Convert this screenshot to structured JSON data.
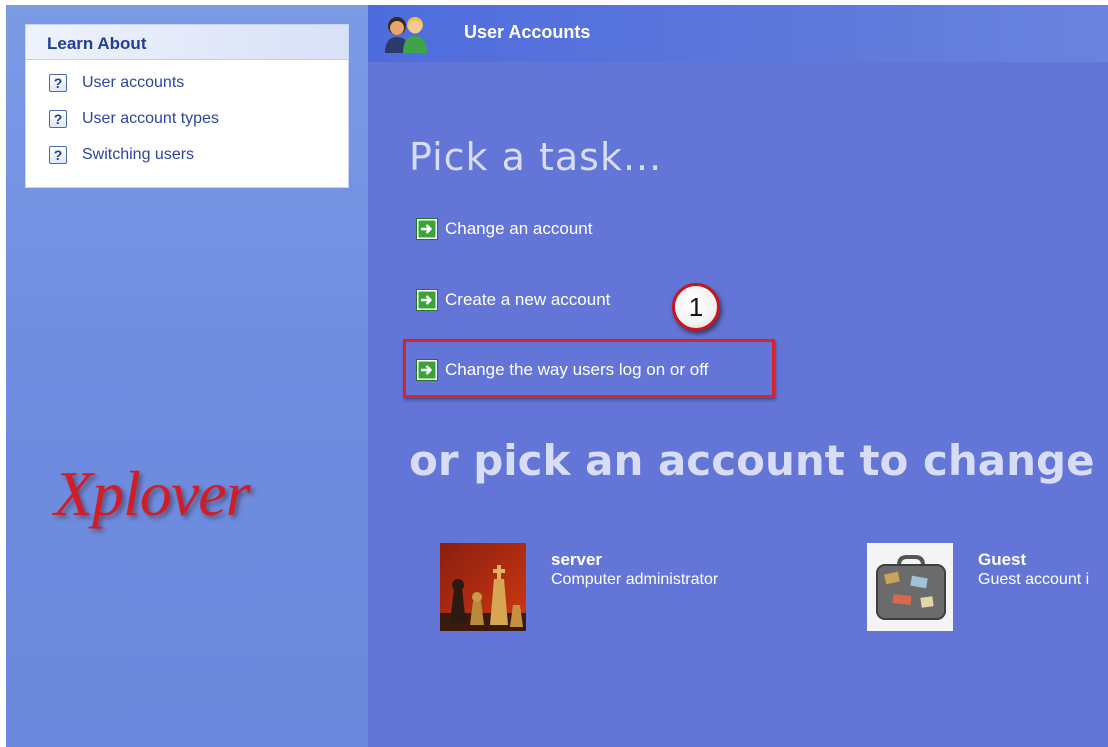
{
  "window": {
    "title": "User Accounts"
  },
  "learn_about": {
    "title": "Learn About",
    "items": [
      {
        "label": "User accounts",
        "icon": "help-icon"
      },
      {
        "label": "User account types",
        "icon": "help-icon"
      },
      {
        "label": "Switching users",
        "icon": "help-icon"
      }
    ]
  },
  "logo": {
    "text": "Xplover"
  },
  "tasks": {
    "heading": "Pick a task...",
    "items": [
      {
        "label": "Change an account",
        "icon": "green-arrow-icon"
      },
      {
        "label": "Create a new account",
        "icon": "green-arrow-icon"
      },
      {
        "label": "Change the way users log on or off",
        "icon": "green-arrow-icon"
      }
    ]
  },
  "annotation": {
    "badge": "1",
    "color": "#d8232b"
  },
  "accounts": {
    "heading": "or pick an account to change",
    "items": [
      {
        "name": "server",
        "type": "Computer administrator",
        "picture": "chess-pieces-picture"
      },
      {
        "name": "Guest",
        "type": "Guest account i",
        "picture": "suitcase-picture"
      }
    ]
  },
  "colors": {
    "main_bg": "#6375d6",
    "left_bg": "#7b9be6",
    "topbar_bg": "#4e6cdd",
    "link_blue": "#2a46a0"
  }
}
